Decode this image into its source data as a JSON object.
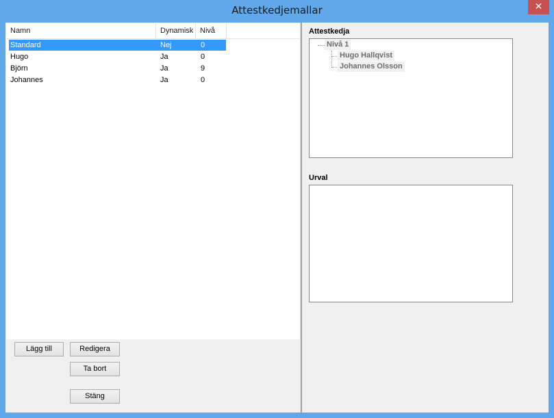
{
  "window": {
    "title": "Attestkedjemallar",
    "close_label": "✕"
  },
  "list": {
    "columns": [
      "Namn",
      "Dynamisk",
      "Nivå"
    ],
    "rows": [
      {
        "name": "Standard",
        "dynamic": "Nej",
        "level": "0",
        "selected": true
      },
      {
        "name": "Hugo",
        "dynamic": "Ja",
        "level": "0",
        "selected": false
      },
      {
        "name": "Björn",
        "dynamic": "Ja",
        "level": "9",
        "selected": false
      },
      {
        "name": "Johannes",
        "dynamic": "Ja",
        "level": "0",
        "selected": false
      }
    ]
  },
  "buttons": {
    "add": "Lägg till",
    "edit": "Redigera",
    "remove": "Ta bort",
    "close": "Stäng"
  },
  "chain": {
    "label": "Attestkedja",
    "root": "Nivå 1",
    "children": [
      "Hugo Hallqvist",
      "Johannes Olsson"
    ]
  },
  "selection": {
    "label": "Urval"
  },
  "colors": {
    "titlebar": "#60a8ea",
    "close": "#c75050",
    "selection": "#3399ff"
  }
}
